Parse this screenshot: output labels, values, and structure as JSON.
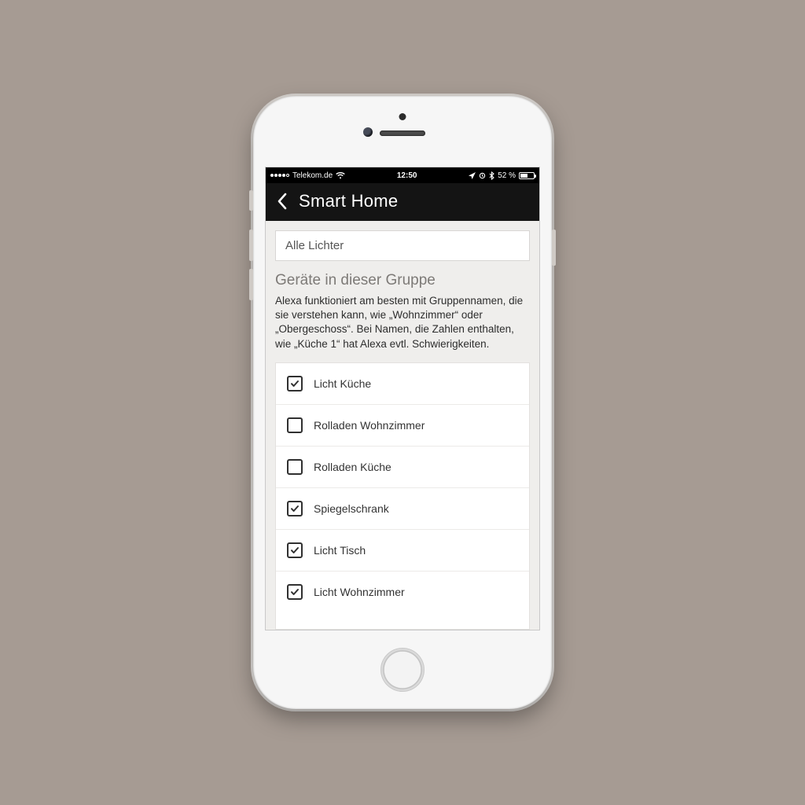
{
  "statusbar": {
    "carrier": "Telekom.de",
    "time": "12:50",
    "battery_pct": "52 %"
  },
  "header": {
    "title": "Smart Home"
  },
  "group": {
    "name_value": "Alle Lichter",
    "section_title": "Geräte in dieser Gruppe",
    "helper": "Alexa funktioniert am besten mit Gruppennamen, die sie verstehen kann, wie „Wohnzimmer“ oder „Obergeschoss“. Bei Namen, die Zahlen enthalten, wie „Küche 1“ hat Alexa evtl. Schwierigkeiten."
  },
  "devices": [
    {
      "label": "Licht Küche",
      "checked": true
    },
    {
      "label": "Rolladen Wohnzimmer",
      "checked": false
    },
    {
      "label": "Rolladen Küche",
      "checked": false
    },
    {
      "label": "Spiegelschrank",
      "checked": true
    },
    {
      "label": "Licht Tisch",
      "checked": true
    },
    {
      "label": "Licht Wohnzimmer",
      "checked": true
    }
  ]
}
